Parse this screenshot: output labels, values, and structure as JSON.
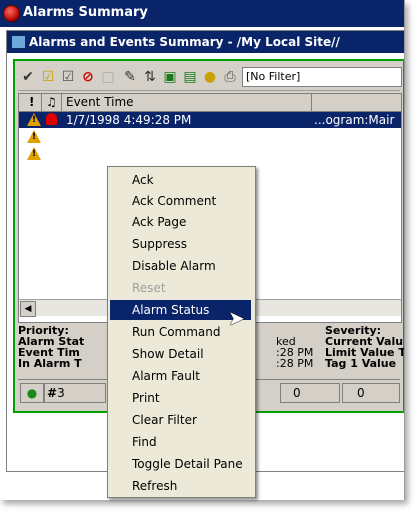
{
  "window": {
    "title": "Alarms Summary"
  },
  "panel": {
    "title": "Alarms and Events Summary - /My Local Site//"
  },
  "toolbar": {
    "filter_value": "[No Filter]"
  },
  "grid": {
    "headers": [
      "!",
      "Event Time"
    ],
    "rows": [
      {
        "time": "1/7/1998 4:49:28 PM",
        "tail": "...ogram:Mair"
      }
    ]
  },
  "detail": {
    "left": [
      "Priority:",
      "Alarm Stat",
      "Event Tim",
      "In Alarm T"
    ],
    "mid_top": "ked",
    "mid": [
      ":28 PM",
      ":28 PM"
    ],
    "right": [
      "Severity:",
      "Current Valu",
      "Limit Value T",
      "Tag 1 Value"
    ]
  },
  "statusbar": {
    "count_a": "3",
    "count_b": "0",
    "count_c": "0"
  },
  "menu": {
    "items": [
      {
        "label": "Ack",
        "state": "normal"
      },
      {
        "label": "Ack Comment",
        "state": "normal"
      },
      {
        "label": "Ack Page",
        "state": "normal"
      },
      {
        "label": "Suppress",
        "state": "normal"
      },
      {
        "label": "Disable Alarm",
        "state": "normal"
      },
      {
        "label": "Reset",
        "state": "disabled"
      },
      {
        "label": "Alarm Status",
        "state": "highlighted"
      },
      {
        "label": "Run Command",
        "state": "normal"
      },
      {
        "label": "Show Detail",
        "state": "normal"
      },
      {
        "label": "Alarm Fault",
        "state": "normal"
      },
      {
        "label": "Print",
        "state": "normal"
      },
      {
        "label": "Clear Filter",
        "state": "normal"
      },
      {
        "label": "Find",
        "state": "normal"
      },
      {
        "label": "Toggle Detail Pane",
        "state": "normal"
      },
      {
        "label": "Refresh",
        "state": "normal"
      }
    ]
  },
  "colors": {
    "titlebar": "#0a246a",
    "border_green": "#00a000",
    "warning": "#e0a000",
    "alarm_red": "#e00000"
  }
}
